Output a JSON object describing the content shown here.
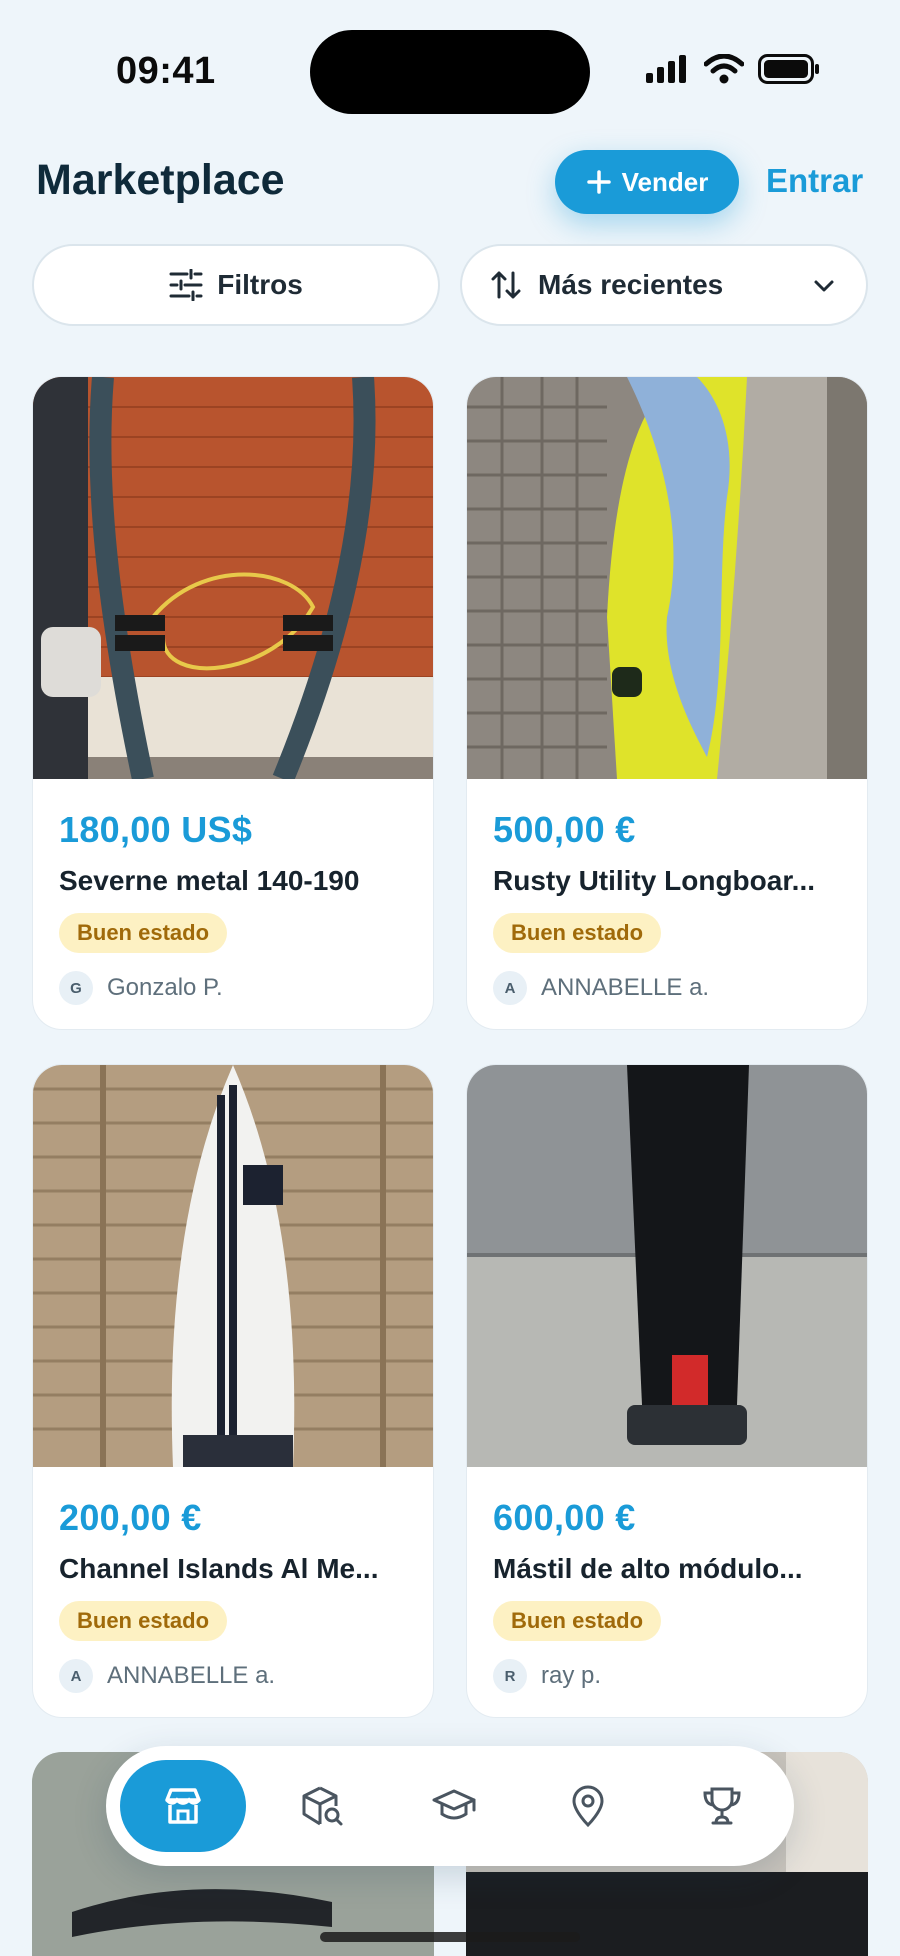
{
  "status_bar": {
    "time": "09:41"
  },
  "header": {
    "title": "Marketplace",
    "sell_label": "Vender",
    "login_label": "Entrar"
  },
  "toolbar": {
    "filters_label": "Filtros",
    "sort_label": "Más recientes"
  },
  "listings": [
    {
      "price": "180,00 US$",
      "title": "Severne metal 140-190",
      "condition": "Buen estado",
      "seller_initial": "G",
      "seller": "Gonzalo P."
    },
    {
      "price": "500,00 €",
      "title": "Rusty Utility Longboar...",
      "condition": "Buen estado",
      "seller_initial": "A",
      "seller": "ANNABELLE a."
    },
    {
      "price": "200,00 €",
      "title": "Channel Islands Al Me...",
      "condition": "Buen estado",
      "seller_initial": "A",
      "seller": "ANNABELLE a."
    },
    {
      "price": "600,00 €",
      "title": "Mástil de alto módulo...",
      "condition": "Buen estado",
      "seller_initial": "R",
      "seller": "ray p."
    }
  ],
  "bottom_nav": {
    "items": [
      {
        "icon": "store-icon",
        "active": true
      },
      {
        "icon": "package-search-icon",
        "active": false
      },
      {
        "icon": "graduation-cap-icon",
        "active": false
      },
      {
        "icon": "map-pin-icon",
        "active": false
      },
      {
        "icon": "trophy-icon",
        "active": false
      }
    ]
  },
  "colors": {
    "accent": "#1a9bd8",
    "badge_bg": "#fdf1c3",
    "badge_text": "#a06a0a",
    "background": "#eef5fa"
  }
}
